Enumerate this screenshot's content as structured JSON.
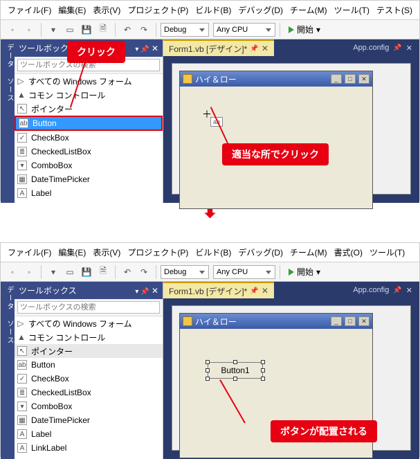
{
  "menu1": {
    "file": "ファイル(F)",
    "edit": "編集(E)",
    "view": "表示(V)",
    "project": "プロジェクト(P)",
    "build": "ビルド(B)",
    "debug": "デバッグ(D)",
    "team": "チーム(M)",
    "tools": "ツール(T)",
    "test": "テスト(S)"
  },
  "menu2": {
    "file": "ファイル(F)",
    "edit": "編集(E)",
    "view": "表示(V)",
    "project": "プロジェクト(P)",
    "build": "ビルド(B)",
    "debug": "デバッグ(D)",
    "team": "チーム(M)",
    "format": "書式(O)",
    "tools": "ツール(T)"
  },
  "toolbar": {
    "config": "Debug",
    "platform": "Any CPU",
    "run": "開始"
  },
  "side_tab_label": "データ ソース",
  "toolbox": {
    "title": "ツールボックス",
    "search_placeholder": "ツールボックスの検索",
    "group_all": "すべての Windows フォーム",
    "group_common": "コモン コントロール",
    "items": [
      "ポインター",
      "Button",
      "CheckBox",
      "CheckedListBox",
      "ComboBox",
      "DateTimePicker",
      "Label"
    ],
    "items2": [
      "ポインター",
      "Button",
      "CheckBox",
      "CheckedListBox",
      "ComboBox",
      "DateTimePicker",
      "Label",
      "LinkLabel"
    ]
  },
  "designer": {
    "tab": "Form1.vb [デザイン]*",
    "right_tab": "App.config",
    "window_title": "ハイ＆ロー",
    "button_text": "Button1"
  },
  "callouts": {
    "click": "クリック",
    "click_here": "適当な所でクリック",
    "placed": "ボタンが配置される"
  }
}
